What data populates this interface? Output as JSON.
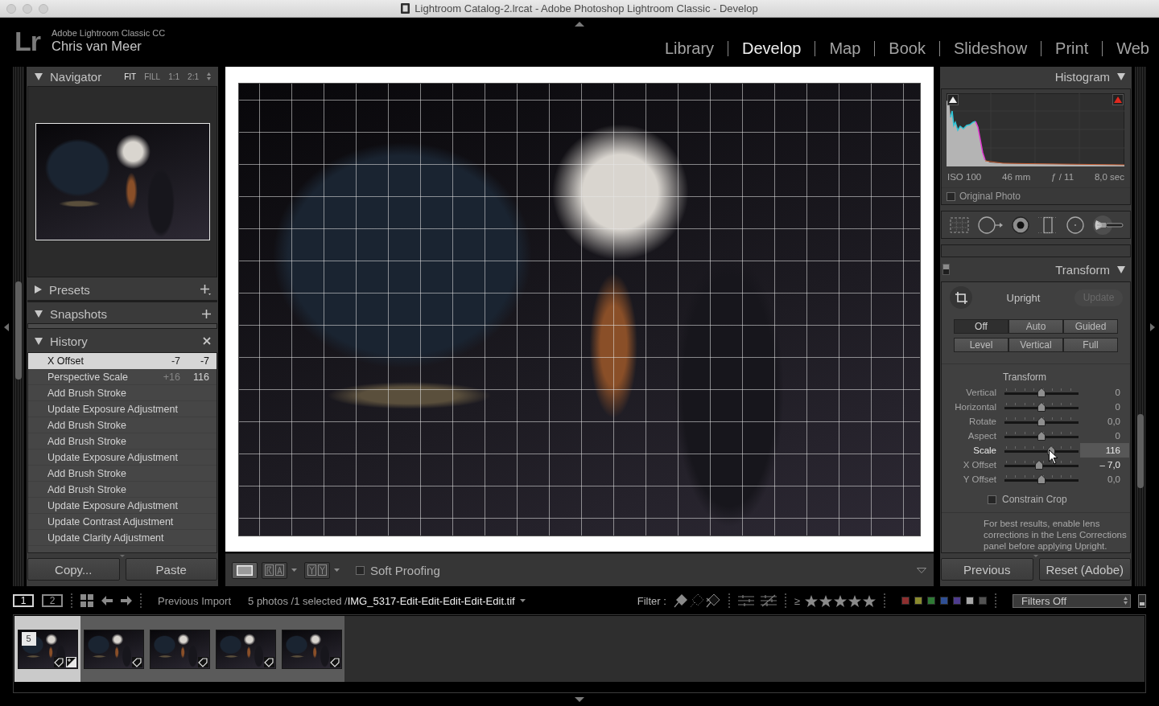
{
  "window": {
    "title": "Lightroom Catalog-2.lrcat - Adobe Photoshop Lightroom Classic - Develop"
  },
  "identity_plate": {
    "logo": "Lr",
    "product": "Adobe Lightroom Classic CC",
    "user": "Chris van Meer"
  },
  "modules": [
    {
      "label": "Library",
      "selected": false
    },
    {
      "label": "Develop",
      "selected": true
    },
    {
      "label": "Map",
      "selected": false
    },
    {
      "label": "Book",
      "selected": false
    },
    {
      "label": "Slideshow",
      "selected": false
    },
    {
      "label": "Print",
      "selected": false
    },
    {
      "label": "Web",
      "selected": false
    }
  ],
  "left_panel": {
    "navigator": {
      "title": "Navigator",
      "expanded": true,
      "zoom_options": [
        {
          "label": "FIT",
          "selected": true
        },
        {
          "label": "FILL",
          "selected": false
        },
        {
          "label": "1:1",
          "selected": false
        },
        {
          "label": "2:1",
          "selected": false
        }
      ]
    },
    "sections": [
      {
        "title": "Presets",
        "expanded": false,
        "kind": "add_menu"
      },
      {
        "title": "Snapshots",
        "expanded": true,
        "kind": "add"
      },
      {
        "title": "History",
        "expanded": true,
        "kind": "clear",
        "items": [
          {
            "label": "X Offset",
            "change": "-7",
            "value": "-7",
            "selected": true
          },
          {
            "label": "Perspective Scale",
            "change": "+16",
            "value": "116",
            "selected": false
          },
          {
            "label": "Add Brush Stroke",
            "selected": false
          },
          {
            "label": "Update Exposure Adjustment",
            "selected": false
          },
          {
            "label": "Add Brush Stroke",
            "selected": false
          },
          {
            "label": "Add Brush Stroke",
            "selected": false
          },
          {
            "label": "Update Exposure Adjustment",
            "selected": false
          },
          {
            "label": "Add Brush Stroke",
            "selected": false
          },
          {
            "label": "Add Brush Stroke",
            "selected": false
          },
          {
            "label": "Update Exposure Adjustment",
            "selected": false
          },
          {
            "label": "Update Contrast Adjustment",
            "selected": false
          },
          {
            "label": "Update Clarity Adjustment",
            "selected": false
          }
        ]
      }
    ],
    "buttons": [
      "Copy...",
      "Paste"
    ]
  },
  "toolbar": {
    "view_modes": [
      {
        "kind": "loupe",
        "selected": true
      },
      {
        "kind": "before_after_side",
        "selected": false
      },
      {
        "kind": "before_after_split",
        "selected": false
      }
    ],
    "soft_proofing": {
      "label": "Soft Proofing",
      "checked": false
    }
  },
  "right_panel": {
    "histogram": {
      "title": "Histogram",
      "expanded": true,
      "exif": [
        "ISO 100",
        "46 mm",
        "ƒ / 11",
        "8,0 sec"
      ],
      "original_photo": {
        "label": "Original Photo",
        "checked": false
      }
    },
    "transform": {
      "title": "Transform",
      "expanded": true,
      "enabled": true,
      "upright_label": "Upright",
      "update_button": {
        "label": "Update",
        "disabled": true
      },
      "upright_modes": [
        {
          "label": "Off",
          "selected": true
        },
        {
          "label": "Auto",
          "selected": false
        },
        {
          "label": "Guided",
          "selected": false
        },
        {
          "label": "Level",
          "selected": false
        },
        {
          "label": "Vertical",
          "selected": false
        },
        {
          "label": "Full",
          "selected": false
        }
      ],
      "subheading": "Transform",
      "sliders": [
        {
          "label": "Vertical",
          "level": 0.5,
          "reading": "0",
          "active": false,
          "edited": false
        },
        {
          "label": "Horizontal",
          "level": 0.5,
          "reading": "0",
          "active": false,
          "edited": false
        },
        {
          "label": "Rotate",
          "level": 0.5,
          "reading": "0,0",
          "active": false,
          "edited": false
        },
        {
          "label": "Aspect",
          "level": 0.5,
          "reading": "0",
          "active": false,
          "edited": false
        },
        {
          "label": "Scale",
          "level": 0.63,
          "reading": "116",
          "active": true,
          "edited": false
        },
        {
          "label": "X Offset",
          "level": 0.47,
          "reading": "– 7,0",
          "active": false,
          "edited": true
        },
        {
          "label": "Y Offset",
          "level": 0.5,
          "reading": "0,0",
          "active": false,
          "edited": false
        }
      ],
      "constrain_crop": {
        "label": "Constrain Crop",
        "checked": false
      },
      "note": "For best results, enable lens corrections in the Lens Corrections panel before applying Upright."
    },
    "buttons": [
      "Previous",
      "Reset (Adobe)"
    ]
  },
  "filmstrip": {
    "screens": [
      {
        "label": "1",
        "selected": true
      },
      {
        "label": "2",
        "selected": false
      }
    ],
    "source": "Previous Import",
    "status": "5 photos /1 selected /**IMG_5317-Edit-Edit-Edit-Edit-Edit.tif**",
    "filter_label": "Filter :",
    "rating_operator": "≥",
    "color_labels": [
      {
        "color": "#8e2f2f"
      },
      {
        "color": "#8a8a2e"
      },
      {
        "color": "#2f7a35"
      },
      {
        "color": "#2f4f94"
      },
      {
        "color": "#4e3c8e"
      },
      {
        "color": "#a8a8a8"
      },
      {
        "color": "#525252"
      }
    ],
    "filter_preset": "Filters Off",
    "thumbnails": [
      {
        "selected": true,
        "stack_count": "5",
        "adjusted": true
      },
      {
        "selected": false,
        "adjusted": false
      },
      {
        "selected": false,
        "adjusted": false
      },
      {
        "selected": false,
        "adjusted": false
      },
      {
        "selected": false,
        "adjusted": false
      }
    ]
  }
}
